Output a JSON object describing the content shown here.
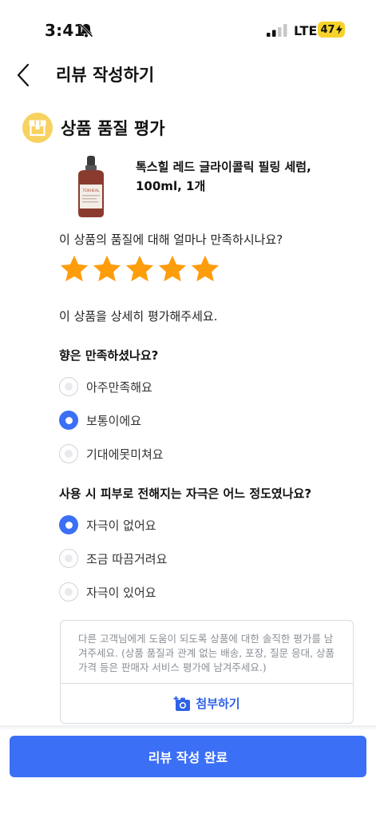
{
  "status": {
    "time": "3:41",
    "network": "LTE",
    "battery": "47"
  },
  "header": {
    "title": "리뷰 작성하기"
  },
  "section": {
    "title": "상품 품질 평가"
  },
  "product": {
    "name": "톡스힐 레드 글라이콜릭 필링 세럼, 100ml, 1개",
    "label_text": "TOXHEAL"
  },
  "rating": {
    "question": "이 상품의 품질에 대해 얼마나 만족하시나요?",
    "value": 5,
    "max": 5,
    "star_color": "#fe9d0b"
  },
  "detail_lead": "이 상품을 상세히 평가해주세요.",
  "questions": [
    {
      "title": "향은 만족하셨나요?",
      "options": [
        "아주만족해요",
        "보통이에요",
        "기대에못미쳐요"
      ],
      "selected": 1
    },
    {
      "title": "사용 시 피부로 전해지는 자극은 어느 정도였나요?",
      "options": [
        "자극이 없어요",
        "조금 따끔거려요",
        "자극이 있어요"
      ],
      "selected": 0
    }
  ],
  "review": {
    "placeholder": "다른 고객님에게 도움이 되도록 상품에 대한 솔직한 평가를 남겨주세요. (상품 품질과 관계 없는 배송, 포장, 질문 응대, 상품 가격 등은 판매자 서비스 평가에 남겨주세요.)",
    "attach_label": "첨부하기"
  },
  "submit_label": "리뷰 작성 완료",
  "colors": {
    "accent": "#3b6ff5",
    "link": "#2f62e8",
    "icon_bg": "#f8d160",
    "battery": "#f7d22a"
  }
}
